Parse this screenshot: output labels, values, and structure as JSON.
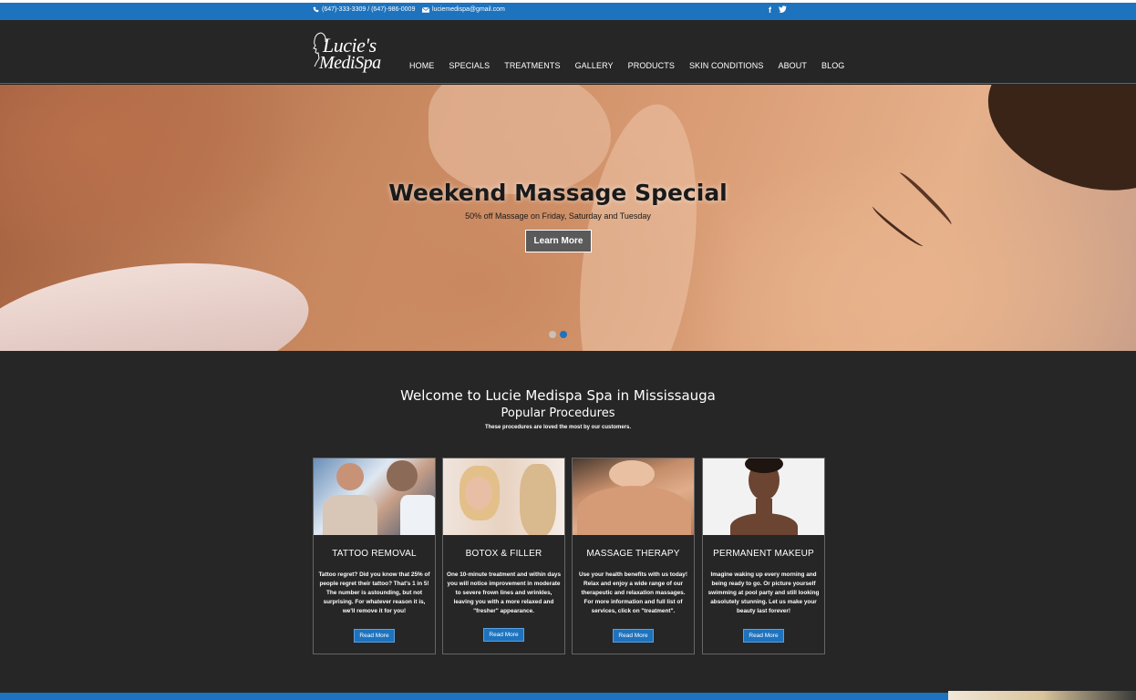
{
  "topbar": {
    "phone": "(647)-333-3309 / (647)-986-0009",
    "email": "luciemedispa@gmail.com",
    "social": [
      {
        "icon": "facebook-icon",
        "glyph": "f"
      },
      {
        "icon": "twitter-icon",
        "glyph": "🐦"
      }
    ]
  },
  "logo": {
    "line1": "Lucie's",
    "line2": "MediSpa"
  },
  "nav": [
    "HOME",
    "SPECIALS",
    "TREATMENTS",
    "GALLERY",
    "PRODUCTS",
    "SKIN CONDITIONS",
    "ABOUT",
    "BLOG"
  ],
  "hero": {
    "title": "Weekend Massage Special",
    "subtitle": "50% off Massage on Friday, Saturday and Tuesday",
    "button": "Learn More",
    "dots": [
      {
        "active": false
      },
      {
        "active": true
      }
    ]
  },
  "welcome": {
    "title": "Welcome to Lucie Medispa Spa in Mississauga",
    "subtitle": "Popular Procedures",
    "tagline": "These procedures are loved the most by our customers."
  },
  "cards": [
    {
      "title": "TATTOO REMOVAL",
      "desc": "Tattoo regret? Did you know that 25% of people regret their tattoo? That's 1 in 5! The number is astounding, but not surprising. For whatever reason it is, we'll remove it for you!",
      "button": "Read More"
    },
    {
      "title": "BOTOX & FILLER",
      "desc": "One 10-minute treatment and within days you will notice improvement in moderate to severe frown lines and wrinkles, leaving you with a more relaxed and \"fresher\" appearance.",
      "button": "Read More"
    },
    {
      "title": "MASSAGE THERAPY",
      "desc": "Use your health benefits with us today! Relax and enjoy a wide range of our therapeutic and relaxation massages. For more information and full list of services, click on \"treatment\".",
      "button": "Read More"
    },
    {
      "title": "PERMANENT MAKEUP",
      "desc": "Imagine waking up every morning and being ready to go. Or picture yourself swimming at pool party and still looking absolutely stunning. Let us make your beauty last forever!",
      "button": "Read More"
    }
  ],
  "colors": {
    "accent": "#1e73be",
    "background": "#262626",
    "dot_inactive": "#c9c0b8"
  }
}
